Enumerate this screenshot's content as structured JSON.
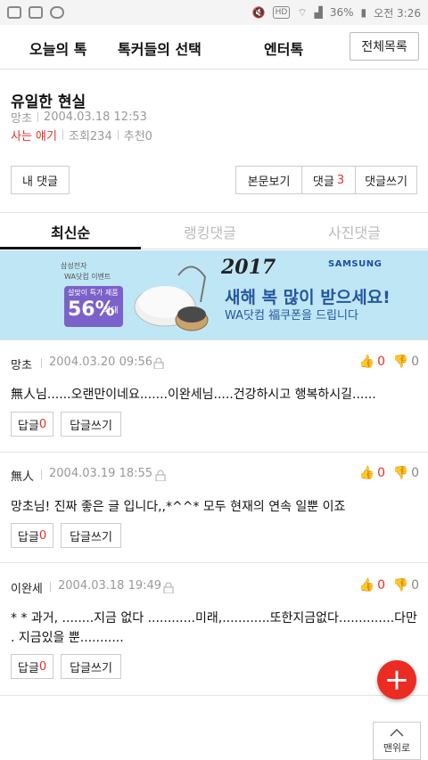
{
  "status_bar": {
    "battery": "36%",
    "time": "오전 3:26"
  },
  "nav": {
    "items": [
      "오늘의 톡",
      "톡커들의 선택",
      "엔터톡"
    ],
    "all": "전체목록"
  },
  "article": {
    "title": "유일한 현실",
    "author": "망초",
    "date": "2004.03.18 12:53",
    "category": "사는 얘기",
    "views_label": "조회",
    "views": "234",
    "recommend_label": "추천",
    "recommend": "0"
  },
  "buttons": {
    "my_comment": "내 댓글",
    "view_body": "본문보기",
    "comments_label": "댓글",
    "comments_count": "3",
    "write_comment": "댓글쓰기"
  },
  "tabs": [
    "최신순",
    "랭킹댓글",
    "사진댓글"
  ],
  "banner": {
    "sponsor_line1": "삼성전자",
    "sponsor_line2": "WA닷컴 이벤트",
    "badge_top": "설맞이 특가 제품",
    "badge_pct": "56%",
    "badge_max": "최대",
    "year": "2017",
    "brand": "SAMSUNG",
    "headline": "새해 복 많이 받으세요!",
    "sub": "WA닷컴 福쿠폰을 드립니다"
  },
  "comments": [
    {
      "author": "망초",
      "date": "2004.03.20 09:56",
      "likes": "0",
      "dislikes": "0",
      "body": "無人님......오랜만이네요.......이완세님.....건강하시고 행복하시길......",
      "reply_label": "답글",
      "reply_count": "0",
      "write_label": "답글쓰기"
    },
    {
      "author": "無人",
      "date": "2004.03.19 18:55",
      "likes": "0",
      "dislikes": "0",
      "body": "망초님! 진짜 좋은 글 입니다,,*^^* 모두 현재의 연속 일뿐 이죠",
      "reply_label": "답글",
      "reply_count": "0",
      "write_label": "답글쓰기"
    },
    {
      "author": "이완세",
      "date": "2004.03.18 19:49",
      "likes": "0",
      "dislikes": "0",
      "body": "* * 과거, ........지금 없다 ............미래,............또한지금없다..............다만 . 지금있을 뿐...........",
      "reply_label": "답글",
      "reply_count": "0",
      "write_label": "답글쓰기"
    }
  ],
  "fab": "+",
  "to_top": "맨위로",
  "colors": {
    "accent": "#e8302a",
    "banner_bg": "#bfe6f5",
    "text": "#222222"
  }
}
